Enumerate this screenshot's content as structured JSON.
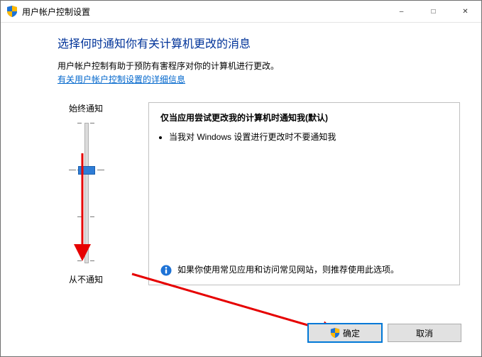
{
  "window": {
    "title": "用户帐户控制设置"
  },
  "heading": "选择何时通知你有关计算机更改的消息",
  "description": "用户帐户控制有助于预防有害程序对你的计算机进行更改。",
  "help_link": "有关用户帐户控制设置的详细信息",
  "slider": {
    "top_label": "始终通知",
    "bottom_label": "从不通知",
    "level_index": 1,
    "level_count": 4
  },
  "panel": {
    "title": "仅当应用尝试更改我的计算机时通知我(默认)",
    "bullets": [
      "当我对 Windows 设置进行更改时不要通知我"
    ],
    "footer": "如果你使用常见应用和访问常见网站，则推荐使用此选项。"
  },
  "buttons": {
    "ok": "确定",
    "cancel": "取消"
  },
  "icons": {
    "shield": "shield-icon",
    "info": "info-icon"
  }
}
